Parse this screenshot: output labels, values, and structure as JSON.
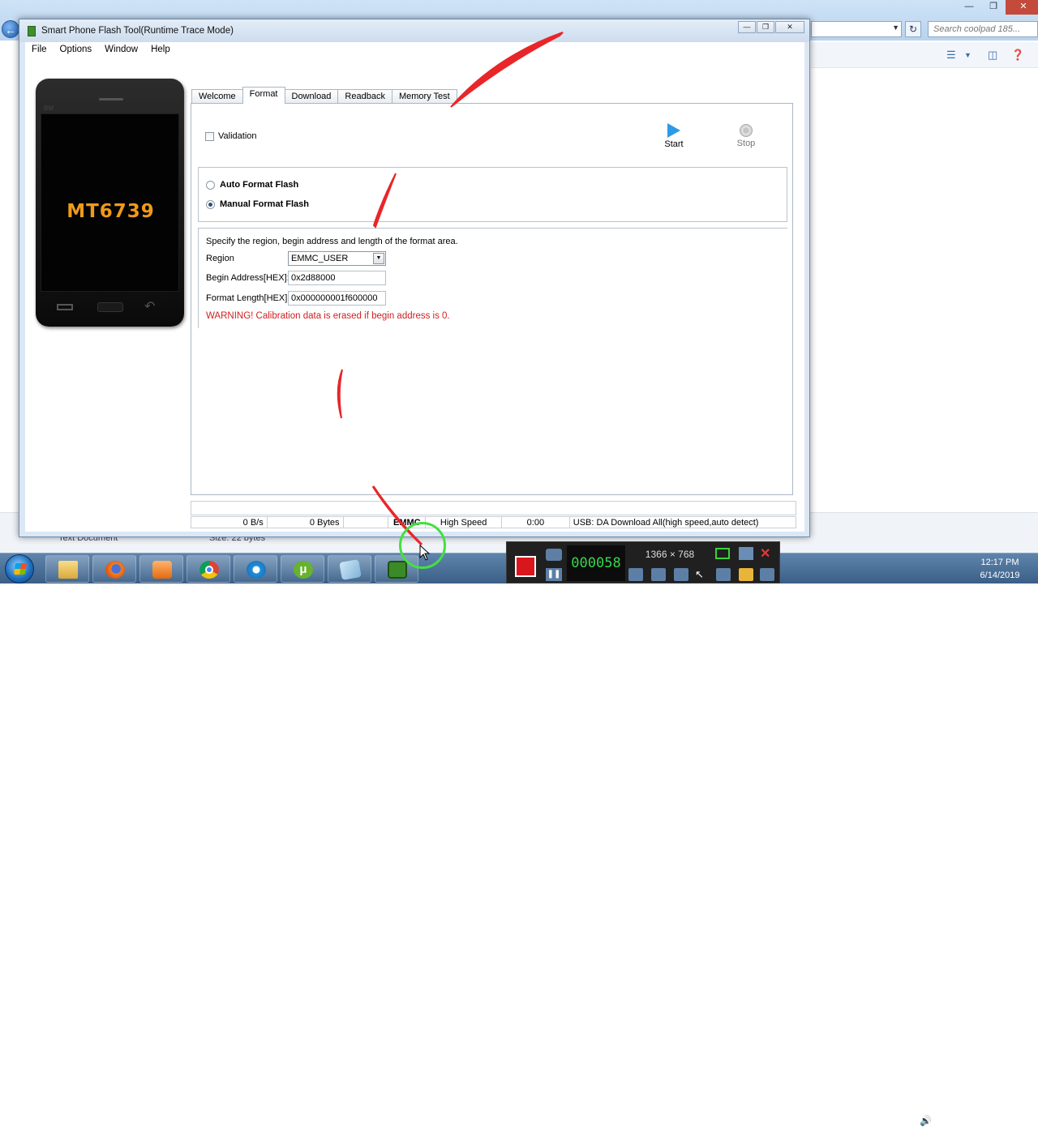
{
  "background_window": {
    "search_placeholder": "Search coolpad 185...",
    "status_item_name": "Text Document",
    "status_item_size": "Size: 22 bytes"
  },
  "window": {
    "title": "Smart Phone Flash Tool(Runtime Trace Mode)"
  },
  "menu": [
    "File",
    "Options",
    "Window",
    "Help"
  ],
  "phone": {
    "chip": "MT6739",
    "brand": "BM"
  },
  "tabs": [
    "Welcome",
    "Format",
    "Download",
    "Readback",
    "Memory Test"
  ],
  "active_tab": "Format",
  "format": {
    "validation_label": "Validation",
    "start_label": "Start",
    "stop_label": "Stop",
    "auto_format_label": "Auto Format Flash",
    "manual_format_label": "Manual Format Flash",
    "selected_mode": "manual",
    "instructions": "Specify the region, begin address and length of the format area.",
    "region_label": "Region",
    "region_value": "EMMC_USER",
    "begin_address_label": "Begin Address[HEX]:",
    "begin_address_value": "0x2d88000",
    "format_length_label": "Format Length[HEX]:",
    "format_length_value": "0x000000001f600000",
    "warning": "WARNING! Calibration data is erased if begin address is 0."
  },
  "status_bar": {
    "speed": "0 B/s",
    "bytes": "0 Bytes",
    "storage": "EMMC",
    "mode": "High Speed",
    "time": "0:00",
    "connection": "USB: DA Download All(high speed,auto detect)"
  },
  "recorder": {
    "timer": "000058",
    "resolution": "1366 × 768",
    "record_color": "#d9161b"
  },
  "clock": {
    "time": "12:17 PM",
    "date": "6/14/2019"
  },
  "colors": {
    "warning": "#d02020",
    "start_accent": "#2d9ae8",
    "chip_label": "#ef9a1a"
  }
}
